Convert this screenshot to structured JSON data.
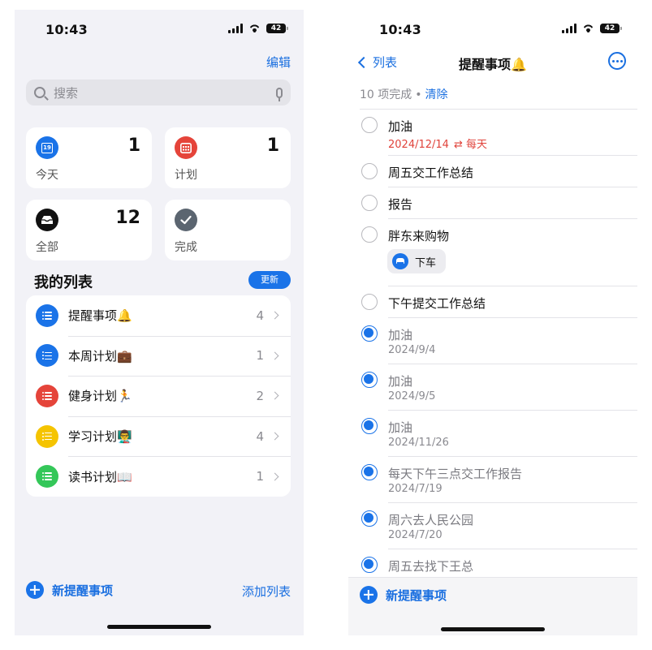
{
  "left": {
    "status": {
      "time": "10:43",
      "battery": "42"
    },
    "edit_label": "编辑",
    "search": {
      "placeholder": "搜索"
    },
    "cards": [
      {
        "label": "今天",
        "count": "1",
        "icon_text": "19",
        "color": "#1a73e8",
        "icon": "calendar-today-icon"
      },
      {
        "label": "计划",
        "count": "1",
        "color": "#e5443a",
        "icon": "calendar-grid-icon"
      },
      {
        "label": "全部",
        "count": "12",
        "color": "#111111",
        "icon": "tray-icon"
      },
      {
        "label": "完成",
        "count": "",
        "color": "#5b6570",
        "icon": "checkmark-icon"
      }
    ],
    "my_lists_title": "我的列表",
    "update_label": "更新",
    "lists": [
      {
        "name": "提醒事项🔔",
        "count": "4",
        "color": "#1a73e8"
      },
      {
        "name": "本周计划💼",
        "count": "1",
        "color": "#1a73e8"
      },
      {
        "name": "健身计划🏃",
        "count": "2",
        "color": "#e5443a"
      },
      {
        "name": "学习计划👨‍🏫",
        "count": "4",
        "color": "#f5c400"
      },
      {
        "name": "读书计划📖",
        "count": "1",
        "color": "#34c759"
      }
    ],
    "new_reminder_label": "新提醒事项",
    "add_list_label": "添加列表"
  },
  "right": {
    "status": {
      "time": "10:43",
      "battery": "42"
    },
    "back_label": "列表",
    "title": "提醒事项🔔",
    "completed_summary": "10 项完成",
    "clear_label": "清除",
    "items": [
      {
        "title": "加油",
        "date": "2024/12/14",
        "repeat": "每天",
        "done": false
      },
      {
        "title": "周五交工作总结",
        "done": false
      },
      {
        "title": "报告",
        "done": false
      },
      {
        "title": "胖东来购物",
        "chip": "下车",
        "done": false
      },
      {
        "title": "下午提交工作总结",
        "done": false
      },
      {
        "title": "加油",
        "date": "2024/9/4",
        "done": true
      },
      {
        "title": "加油",
        "date": "2024/9/5",
        "done": true
      },
      {
        "title": "加油",
        "date": "2024/11/26",
        "done": true
      },
      {
        "title": "每天下午三点交工作报告",
        "date": "2024/7/19",
        "done": true
      },
      {
        "title": "周六去人民公园",
        "date": "2024/7/20",
        "done": true
      },
      {
        "title": "周五去找下王总",
        "done": true
      }
    ],
    "new_reminder_label": "新提醒事项",
    "accent_color": "#1a73e8",
    "overdue_color": "#e0433b"
  }
}
